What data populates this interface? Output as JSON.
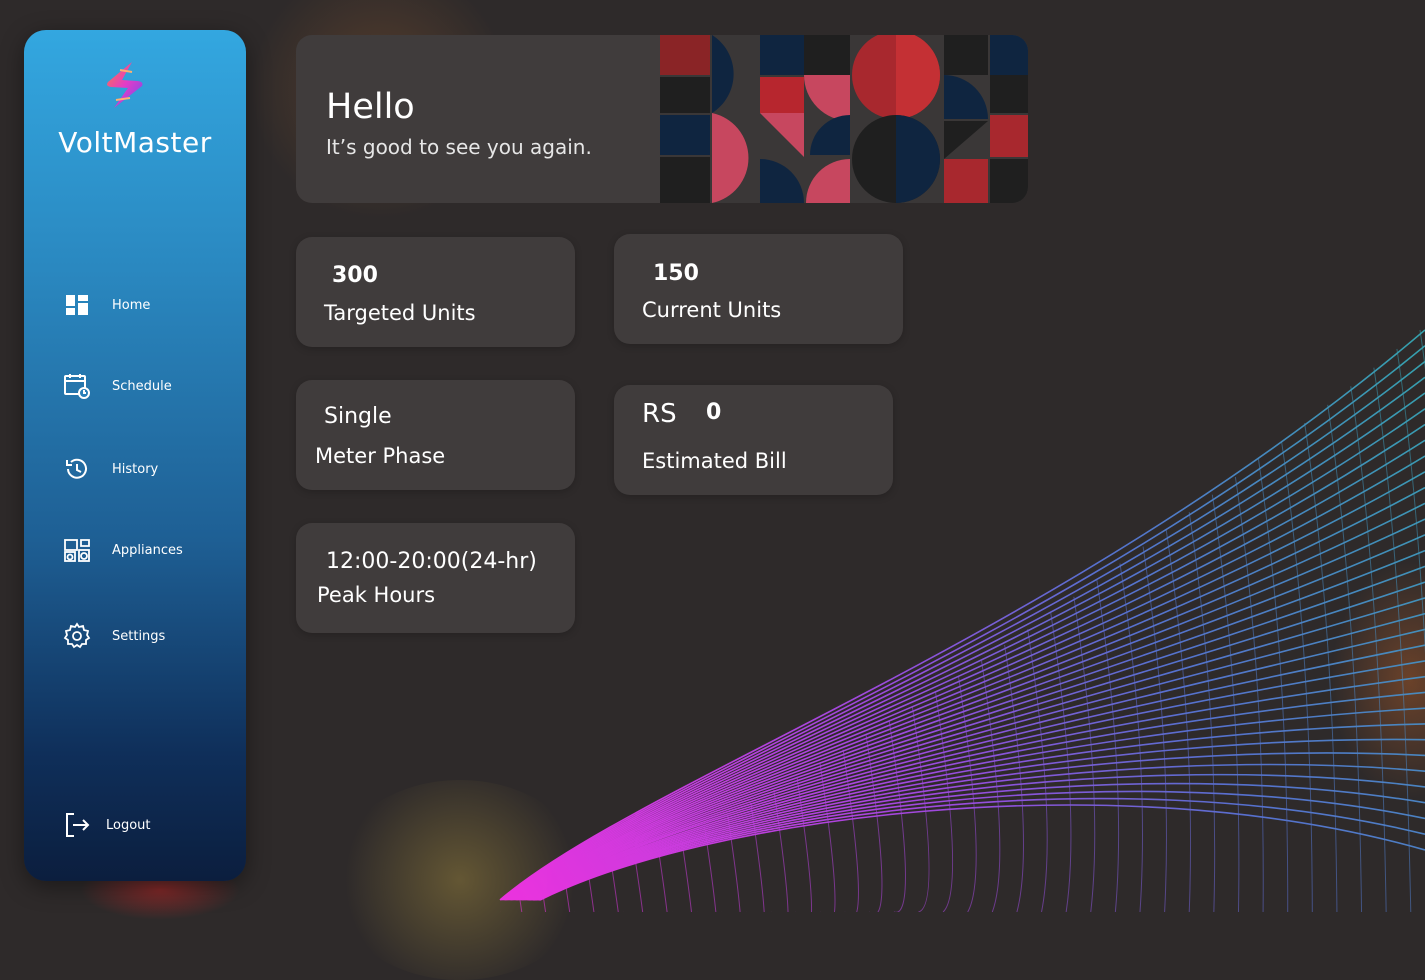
{
  "app": {
    "brand": "VoltMaster"
  },
  "sidebar": {
    "items": [
      {
        "label": "Home",
        "icon": "dashboard-icon"
      },
      {
        "label": "Schedule",
        "icon": "calendar-clock-icon"
      },
      {
        "label": "History",
        "icon": "history-icon"
      },
      {
        "label": "Appliances",
        "icon": "appliances-icon"
      },
      {
        "label": "Settings",
        "icon": "gear-icon"
      }
    ],
    "logout": {
      "label": "Logout",
      "icon": "logout-icon"
    }
  },
  "greeting": {
    "title": "Hello",
    "subtitle": "It’s good to see you again."
  },
  "cards": {
    "targeted": {
      "value": "300",
      "label": "Targeted Units"
    },
    "current": {
      "value": "150",
      "label": "Current Units"
    },
    "phase": {
      "value": "Single",
      "label": "Meter Phase"
    },
    "bill": {
      "currency": "RS",
      "value": "0",
      "label": "Estimated Bill"
    },
    "peak": {
      "value": "12:00-20:00(24-hr)",
      "label": "Peak Hours"
    }
  },
  "colors": {
    "background": "#2e2a2a",
    "card": "#403c3c",
    "sidebar_top": "#33a7e0",
    "sidebar_bottom": "#0b1e3e",
    "wave_magenta": "#e83cf0",
    "wave_teal": "#3aa7b8"
  }
}
